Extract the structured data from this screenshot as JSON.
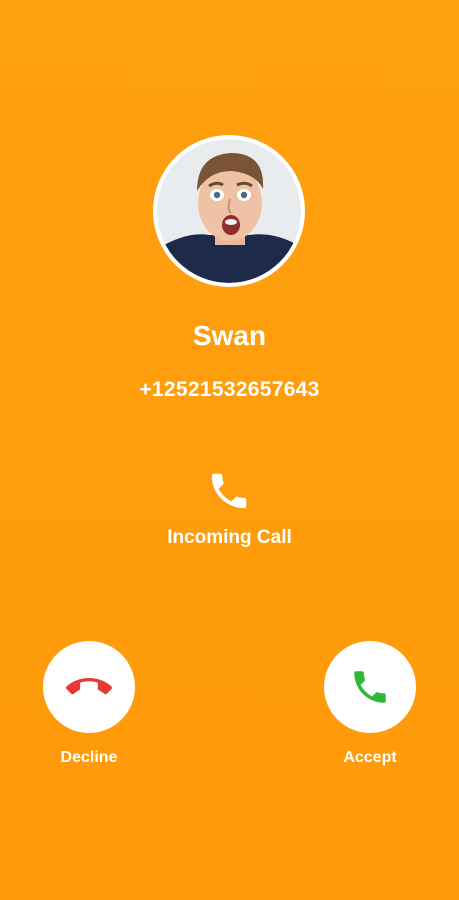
{
  "caller": {
    "name": "Swan",
    "number": "+12521532657643"
  },
  "call_status": {
    "text": "Incoming Call",
    "icon": "phone-icon"
  },
  "actions": {
    "decline": {
      "label": "Decline",
      "icon": "phone-hangup-icon",
      "color": "#E53935"
    },
    "accept": {
      "label": "Accept",
      "icon": "phone-icon",
      "color": "#2EB83A"
    }
  },
  "colors": {
    "background": "#FF9D0D",
    "text": "#FFFFFF"
  }
}
